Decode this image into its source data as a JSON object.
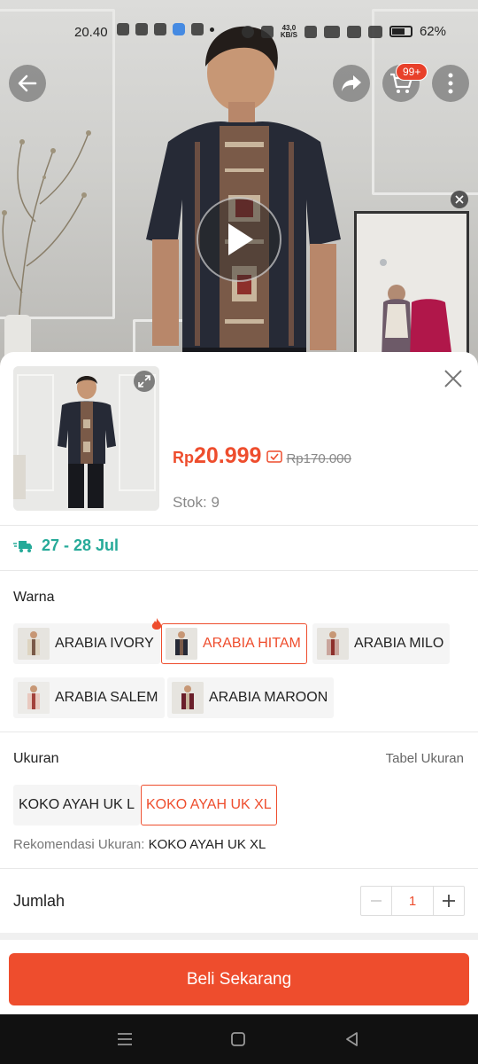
{
  "status_bar": {
    "time": "20.40",
    "net_speed": "43,0\nKB/S",
    "battery": "62%"
  },
  "header": {
    "cart_badge": "99+"
  },
  "product": {
    "currency": "Rp",
    "price": "20.999",
    "original_price": "Rp170.000",
    "stock": "Stok: 9"
  },
  "delivery": {
    "dates": "27 - 28 Jul"
  },
  "color_section": {
    "label": "Warna",
    "options": [
      {
        "label": "ARABIA IVORY",
        "selected": false,
        "hot": true
      },
      {
        "label": "ARABIA HITAM",
        "selected": true,
        "hot": false
      },
      {
        "label": "ARABIA MILO",
        "selected": false,
        "hot": false
      },
      {
        "label": "ARABIA SALEM",
        "selected": false,
        "hot": false
      },
      {
        "label": "ARABIA MAROON",
        "selected": false,
        "hot": false
      }
    ]
  },
  "size_section": {
    "label": "Ukuran",
    "size_table_link": "Tabel Ukuran",
    "options": [
      {
        "label": "KOKO AYAH UK L",
        "selected": false
      },
      {
        "label": "KOKO AYAH UK XL",
        "selected": true
      }
    ],
    "recommendation_label": "Rekomendasi Ukuran:",
    "recommendation_value": "KOKO AYAH UK XL"
  },
  "quantity": {
    "label": "Jumlah",
    "value": "1"
  },
  "buy_button": {
    "label": "Beli Sekarang"
  },
  "colors": {
    "accent": "#ee4d2d",
    "delivery": "#26aa99"
  }
}
